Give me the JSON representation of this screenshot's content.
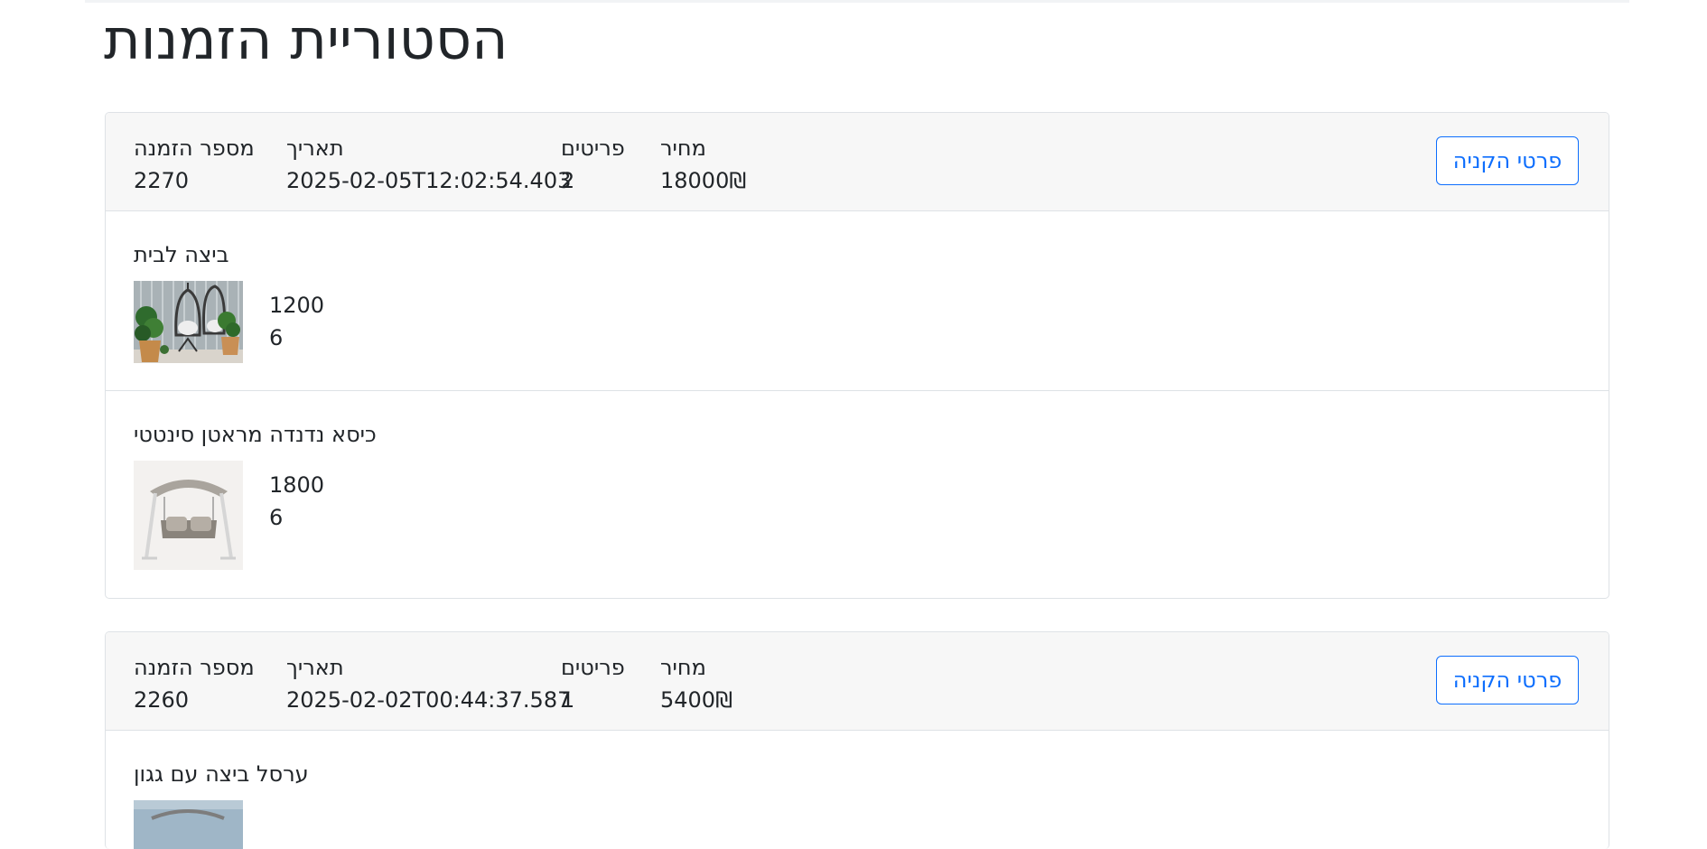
{
  "page": {
    "title": "הסטוריית הזמנות"
  },
  "labels": {
    "order_number": "מספר הזמנה",
    "date": "תאריך",
    "items": "פריטים",
    "price": "מחיר",
    "details_button": "פרטי הקניה"
  },
  "orders": [
    {
      "order_number": "2270",
      "date": "2025-02-05T12:02:54.403",
      "items_count": "2",
      "price": "18000₪",
      "items": [
        {
          "name": "ביצה לבית",
          "price": "1200",
          "quantity": "6",
          "image": "hanging-egg-chair-with-plants"
        },
        {
          "name": "כיסא נדנדה מראטן סינטטי",
          "price": "1800",
          "quantity": "6",
          "image": "rattan-swing-chair-with-canopy"
        }
      ]
    },
    {
      "order_number": "2260",
      "date": "2025-02-02T00:44:37.587",
      "items_count": "1",
      "price": "5400₪",
      "items": [
        {
          "name": "ערסל ביצה עם גגון",
          "image": "egg-hammock-with-canopy"
        }
      ]
    }
  ]
}
